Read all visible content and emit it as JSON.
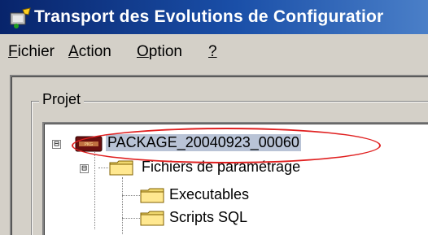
{
  "window": {
    "title": "Transport des Evolutions de Configuratior",
    "app_icon": "app-icon"
  },
  "menu": [
    {
      "label_ul": "F",
      "label_rest": "ichier"
    },
    {
      "label_ul": "A",
      "label_rest": "ction"
    },
    {
      "label_ul": "O",
      "label_rest": "ption"
    },
    {
      "label_ul": "?",
      "label_rest": ""
    }
  ],
  "group": {
    "label": "Projet"
  },
  "tree": {
    "root": {
      "label": "PACKAGE_20040923_00060",
      "expander": "⊟",
      "icon": "package-icon"
    },
    "child": {
      "label": "Fichiers de paramétrage",
      "expander": "⊟",
      "icon": "folder-icon"
    },
    "leaves": [
      {
        "label": "Executables",
        "icon": "folder-icon"
      },
      {
        "label": "Scripts SQL",
        "icon": "folder-icon"
      }
    ]
  },
  "colors": {
    "highlight": "#e02020",
    "titlebar": "#08246b",
    "selection": "#b9c3d6"
  }
}
